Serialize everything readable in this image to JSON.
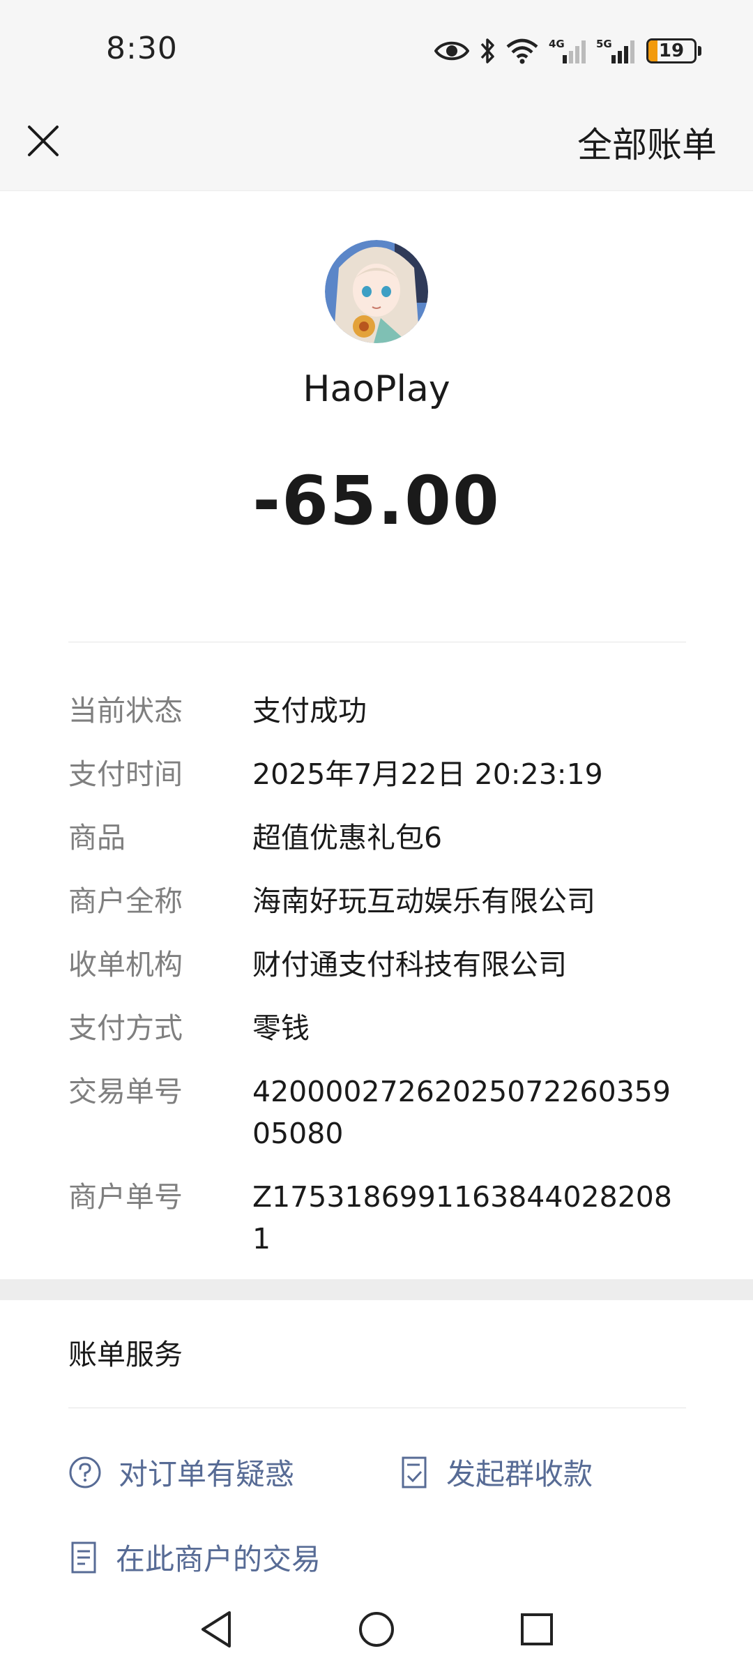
{
  "status_bar": {
    "time": "8:30",
    "network_4g": "4G",
    "network_5g": "5G",
    "battery": "19",
    "battery_level": 0.19,
    "icons": [
      "eye-icon",
      "bluetooth-icon",
      "wifi-icon",
      "signal-4g-icon",
      "signal-5g-icon",
      "battery-icon"
    ]
  },
  "header": {
    "close_icon": "close-icon",
    "all_bills": "全部账单"
  },
  "merchant": {
    "name": "HaoPlay",
    "amount": "-65.00"
  },
  "details": [
    {
      "label": "当前状态",
      "value": "支付成功"
    },
    {
      "label": "支付时间",
      "value": "2025年7月22日 20:23:19"
    },
    {
      "label": "商品",
      "value": "超值优惠礼包6"
    },
    {
      "label": "商户全称",
      "value": "海南好玩互动娱乐有限公司"
    },
    {
      "label": "收单机构",
      "value": "财付通支付科技有限公司"
    },
    {
      "label": "支付方式",
      "value": "零钱"
    },
    {
      "label": "交易单号",
      "value": "4200002726202507226035905080"
    },
    {
      "label": "商户单号",
      "value": "Z17531869911638440282081"
    }
  ],
  "services": {
    "title": "账单服务",
    "order_question": "对订单有疑惑",
    "group_collect": "发起群收款",
    "merchant_transactions": "在此商户的交易"
  },
  "nav": {
    "icons": [
      "back-triangle-icon",
      "home-circle-icon",
      "recents-square-icon"
    ]
  },
  "colors": {
    "link": "#576b95",
    "battery": "#f29a0c",
    "label_gray": "#7f7f7f"
  }
}
